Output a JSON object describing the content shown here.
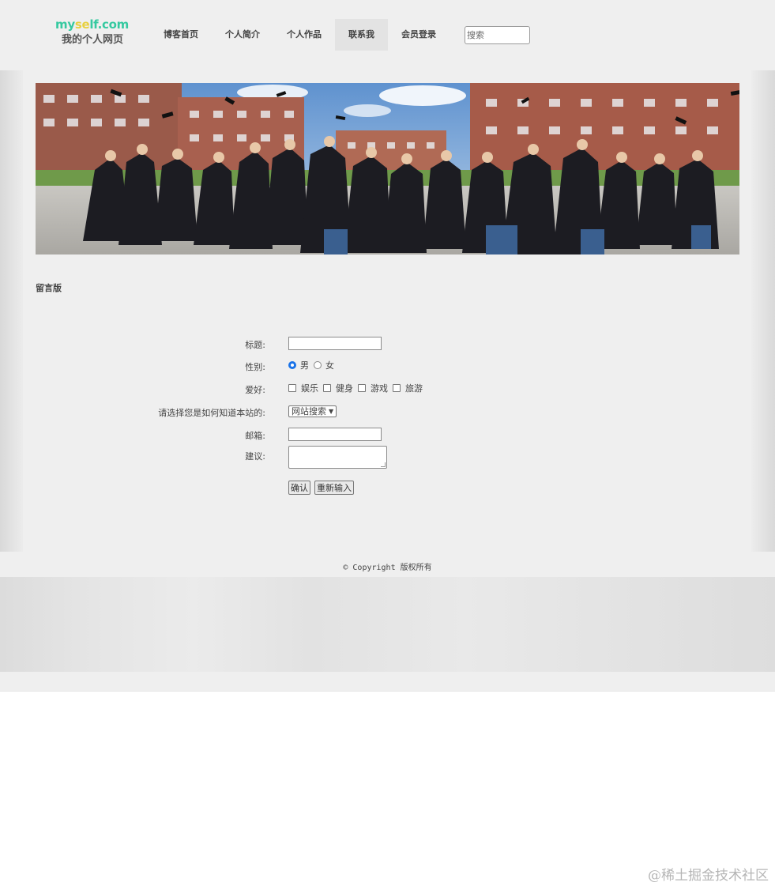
{
  "header": {
    "logo_top_a": "my",
    "logo_top_b": "se",
    "logo_top_c": "lf.com",
    "logo_bottom": "我的个人网页",
    "nav": [
      {
        "label": "博客首页",
        "active": false
      },
      {
        "label": "个人简介",
        "active": false
      },
      {
        "label": "个人作品",
        "active": false
      },
      {
        "label": "联系我",
        "active": true
      },
      {
        "label": "会员登录",
        "active": false
      }
    ],
    "search_placeholder": "搜索"
  },
  "main": {
    "section_title": "留言版",
    "form": {
      "title_label": "标题:",
      "gender_label": "性别:",
      "gender_options": [
        "男",
        "女"
      ],
      "gender_selected": "男",
      "hobby_label": "爱好:",
      "hobby_options": [
        "娱乐",
        "健身",
        "游戏",
        "旅游"
      ],
      "source_label": "请选择您是如何知道本站的:",
      "source_selected": "网站搜索",
      "email_label": "邮箱:",
      "suggestion_label": "建议:",
      "confirm_button": "确认",
      "reset_button": "重新输入"
    }
  },
  "footer": {
    "copyright": "© Copyright 版权所有"
  },
  "watermark": "@稀土掘金技术社区",
  "colors": {
    "header_bg": "#efefef",
    "nav_active_bg": "#e3e3e3",
    "logo_green": "#35c9a0",
    "radio_accent": "#1a73e8"
  }
}
